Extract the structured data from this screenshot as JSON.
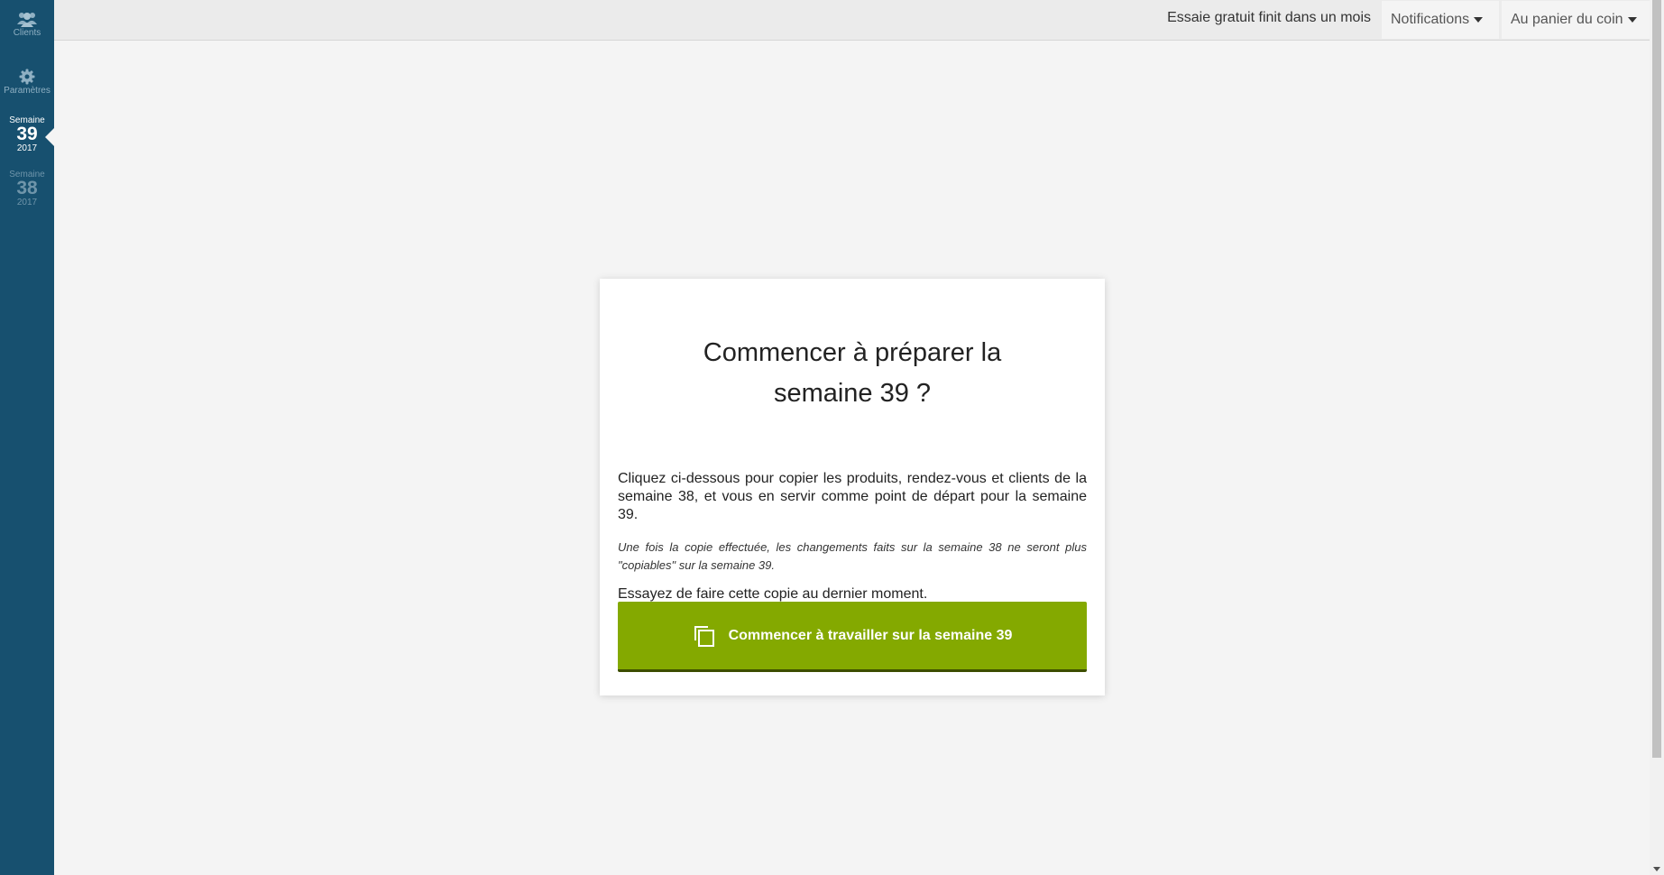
{
  "sidebar": {
    "clients_label": "Clients",
    "settings_label": "Paramètres",
    "weeks": [
      {
        "label": "Semaine",
        "number": "39",
        "year": "2017",
        "active": true
      },
      {
        "label": "Semaine",
        "number": "38",
        "year": "2017",
        "active": false
      }
    ]
  },
  "header": {
    "trial_text": "Essaie gratuit finit dans un mois",
    "notifications_label": "Notifications",
    "user_label": "Au panier du coin"
  },
  "card": {
    "title": "Commencer à préparer la semaine 39 ?",
    "description": "Cliquez ci-dessous pour copier les produits, rendez-vous et clients de la semaine 38, et vous en servir comme point de départ pour la semaine 39.",
    "note": "Une fois la copie effectuée, les changements faits sur la semaine 38 ne seront plus \"copiables\" sur la semaine 39.",
    "hint": "Essayez de faire cette copie au dernier moment.",
    "button_label": "Commencer à travailler sur la semaine 39"
  },
  "colors": {
    "sidebar_bg": "#17506f",
    "accent_green": "#84a900",
    "page_bg": "#f4f4f4"
  }
}
